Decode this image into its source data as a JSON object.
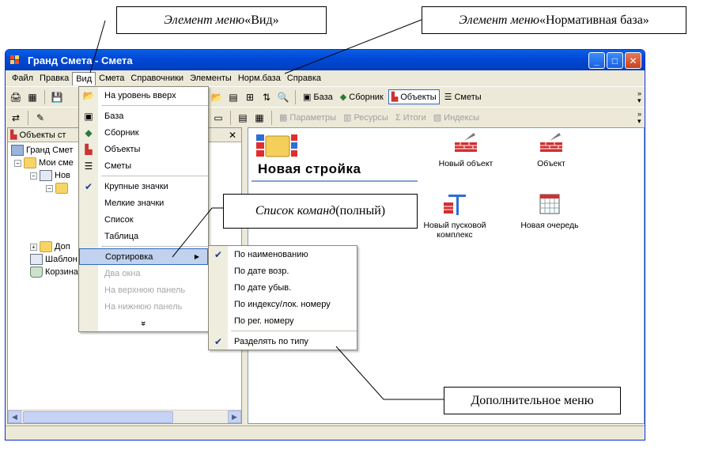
{
  "callouts": {
    "view_menu_item": {
      "italic": "Элемент меню",
      "normal": " «Вид»"
    },
    "normbase_item": {
      "italic": "Элемент меню",
      "normal": " «Нормативная база»"
    },
    "command_list": {
      "italic": "Список команд",
      "normal": " (полный)"
    },
    "extra_menu": {
      "text": "Дополнительное меню"
    }
  },
  "window": {
    "title": "Гранд Смета - Смета"
  },
  "menubar": [
    "Файл",
    "Правка",
    "Вид",
    "Смета",
    "Справочники",
    "Элементы",
    "Норм.база",
    "Справка"
  ],
  "toolbar1": {
    "buttons": [
      "База",
      "Сборник",
      "Объекты",
      "Сметы"
    ],
    "pressed": "Объекты"
  },
  "toolbar2": {
    "buttons": [
      "Параметры",
      "Ресурсы",
      "Итоги",
      "Индексы"
    ]
  },
  "left_pane": {
    "header": "Объекты ст",
    "tree": [
      "Гранд Смет",
      "Мои сме",
      "Нов",
      "Доп",
      "Шаблон",
      "Корзина"
    ]
  },
  "right_pane": {
    "title": "Новая стройка",
    "items": [
      "Новый объект",
      "Объект",
      "Новый пусковой комплекс",
      "Новая очередь"
    ]
  },
  "view_menu": {
    "items": [
      {
        "label": "На уровень вверх",
        "icon": "up-folder-icon"
      },
      {
        "sep": true
      },
      {
        "label": "База",
        "icon": "base-icon"
      },
      {
        "label": "Сборник",
        "icon": "book-icon"
      },
      {
        "label": "Объекты",
        "icon": "objects-icon"
      },
      {
        "label": "Сметы",
        "icon": "estimates-icon"
      },
      {
        "sep": true
      },
      {
        "label": "Крупные значки",
        "checked": true
      },
      {
        "label": "Мелкие значки"
      },
      {
        "label": "Список"
      },
      {
        "label": "Таблица"
      },
      {
        "sep": true
      },
      {
        "label": "Сортировка",
        "submenu": true,
        "selected": true
      },
      {
        "label": "Два окна",
        "disabled": true
      },
      {
        "label": "На верхнюю панель",
        "disabled": true
      },
      {
        "label": "На нижнюю панель",
        "disabled": true
      }
    ],
    "expand": "»"
  },
  "sort_submenu": {
    "items": [
      {
        "label": "По наименованию",
        "checked": true
      },
      {
        "label": "По дате возр."
      },
      {
        "label": "По дате убыв."
      },
      {
        "label": "По индексу/лок. номеру"
      },
      {
        "label": "По рег. номеру"
      },
      {
        "sep": true
      },
      {
        "label": "Разделять по типу",
        "checked": true
      }
    ]
  },
  "colors": {
    "titlebar": "#0054e3",
    "menu_highlight": "#c1d2ee",
    "accent": "#316ac5"
  }
}
